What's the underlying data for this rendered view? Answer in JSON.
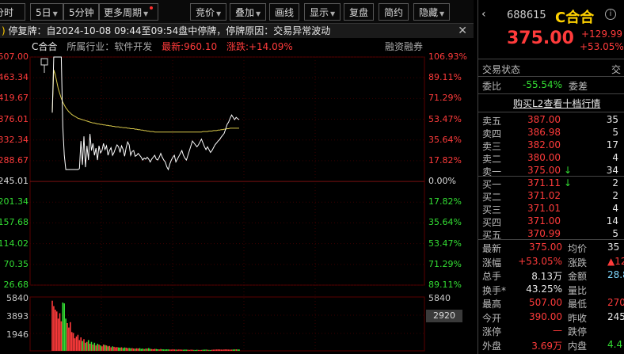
{
  "toolbar": {
    "tab_code": "分时",
    "days": "5日",
    "minute": "5分钟",
    "more_period": "更多周期",
    "auction": "竞价",
    "overlay": "叠加",
    "draw": "画线",
    "display": "显示",
    "review": "复盘",
    "simple": "简约",
    "hide": "隐藏"
  },
  "notice": {
    "text": "停复牌：自2024-10-08 09:44至09:54盘中停牌，停牌原因：交易异常波动",
    "close": "✕"
  },
  "info": {
    "name": "C合合",
    "industry": "所属行业：软件开发",
    "latest": "最新:960.10",
    "change": "涨跌:+14.09%",
    "margin": "融资融券"
  },
  "colors": {
    "up": "#ff3b3b",
    "down": "#33dd33",
    "price_line": "#ffffff",
    "avg_line": "#d8c84a",
    "text": "#c8c8c8",
    "yellow": "#ffd200",
    "blue_label": "#7ab7ff"
  },
  "price_axis": {
    "left_labels": [
      "507.00",
      "463.34",
      "419.67",
      "376.01",
      "332.34",
      "288.67",
      "245.01",
      "201.34",
      "157.68",
      "114.02",
      "70.35",
      "26.68"
    ],
    "right_labels": [
      "106.93%",
      "89.11%",
      "71.29%",
      "53.47%",
      "35.64%",
      "17.82%",
      "0.00%",
      "17.82%",
      "35.64%",
      "53.47%",
      "71.29%",
      "89.11%"
    ]
  },
  "volume_axis": {
    "left_labels": [
      "5840",
      "3893",
      "1946"
    ],
    "right_labels": [
      "5840",
      "3893"
    ],
    "current": "2920"
  },
  "chart_data": {
    "type": "line",
    "x_label": "",
    "y_range": [
      26.68,
      507.0
    ],
    "prev_close": 245.01,
    "series": [
      {
        "values": [
          390.0,
          507.0,
          507.0,
          507.0,
          507.0,
          507.0,
          507.0,
          360.0,
          300.0,
          270.0,
          270.0,
          270.0,
          270.0,
          270.0,
          270.0,
          270.0,
          270.0,
          270.0,
          272.0,
          330.0,
          280.0,
          340.0,
          275.0,
          320.0,
          290.0,
          345.0,
          310.0,
          325.0,
          300.0,
          315.0,
          290.0,
          320.0,
          305.0,
          310.0,
          325.0,
          312.0,
          320.0,
          300.0,
          310.0,
          316.0,
          300.0,
          306.0,
          315.0,
          322.0,
          318.0,
          306.0,
          320.0,
          312.0,
          298.0,
          316.0,
          328.0,
          322.0,
          300.0,
          308.0,
          310.0,
          298.0,
          300.0,
          304.0,
          300.0,
          296.0,
          290.0,
          294.0,
          292.0,
          296.0,
          292.0,
          286.0,
          292.0,
          296.0,
          300.0,
          292.0,
          290.0,
          296.0,
          304.0,
          296.0,
          290.0,
          286.0,
          276.0,
          270.0,
          282.0,
          290.0,
          296.0,
          300.0,
          286.0,
          292.0,
          298.0,
          304.0,
          310.0,
          300.0,
          294.0,
          290.0,
          300.0,
          310.0,
          320.0,
          330.0,
          326.0,
          322.0,
          318.0,
          322.0,
          328.0,
          334.0,
          326.0,
          318.0,
          312.0,
          318.0,
          312.0,
          306.0,
          310.0,
          316.0,
          322.0,
          326.0,
          330.0,
          333.0,
          338.0,
          342.0,
          346.0,
          355.0,
          365.0,
          370.0,
          378.0,
          385.0,
          380.0,
          375.0,
          380.0,
          377.0,
          375.0
        ]
      },
      {
        "values": [
          390.0,
          480.0,
          470.0,
          455.0,
          440.0,
          430.0,
          420.0,
          412.0,
          406.0,
          400.0,
          396.0,
          392.0,
          389.0,
          386.0,
          384.0,
          382.0,
          380.0,
          378.0,
          377.0,
          376.0,
          375.0,
          374.0,
          373.0,
          372.0,
          371.0,
          370.0,
          369.0,
          368.0,
          368.0,
          367.0,
          366.0,
          366.0,
          365.0,
          365.0,
          364.0,
          364.0,
          363.0,
          363.0,
          362.0,
          362.0,
          361.0,
          361.0,
          360.0,
          360.0,
          360.0,
          359.0,
          359.0,
          358.0,
          358.0,
          358.0,
          357.0,
          357.0,
          356.0,
          356.0,
          356.0,
          355.0,
          355.0,
          354.0,
          354.0,
          353.0,
          353.0,
          352.0,
          352.0,
          351.0,
          351.0,
          350.0,
          350.0,
          350.0,
          349.0,
          349.0,
          349.0,
          349.0,
          349.0,
          349.0,
          349.0,
          349.0,
          349.0,
          349.0,
          349.0,
          349.0,
          349.0,
          349.0,
          349.0,
          349.0,
          349.0,
          349.0,
          349.0,
          349.0,
          349.0,
          349.0,
          349.0,
          349.0,
          349.0,
          349.0,
          349.0,
          349.0,
          349.0,
          349.0,
          349.0,
          349.0,
          350.0,
          350.0,
          350.0,
          350.0,
          351.0,
          351.0,
          351.0,
          352.0,
          352.0,
          352.0,
          353.0,
          353.0,
          354.0,
          354.0,
          355.0,
          355.0,
          356.0,
          356.0,
          357.0,
          357.0,
          357.0,
          357.0,
          357.0,
          357.0,
          357.0
        ]
      }
    ],
    "volume": [
      5600,
      5000,
      4600,
      4400,
      3600,
      4200,
      3300,
      5400,
      5300,
      3600,
      3100,
      2600,
      3200,
      2100,
      2000,
      1400,
      1600,
      1800,
      1200,
      1500,
      1100,
      1300,
      900,
      1000,
      1200,
      800,
      1000,
      700,
      900,
      600,
      800,
      700,
      600,
      500,
      700,
      650,
      600,
      500,
      550,
      400,
      500,
      450,
      400,
      420,
      380,
      350,
      400,
      300,
      380,
      350,
      300,
      320,
      280,
      300,
      260,
      240,
      280,
      260,
      300,
      220,
      250,
      200,
      240,
      260,
      300,
      220,
      200,
      180,
      220,
      200,
      180,
      160,
      200,
      180,
      160,
      150,
      170,
      160,
      150,
      140,
      160,
      150,
      140,
      130,
      150,
      140,
      130,
      120,
      140,
      130,
      120,
      110,
      130,
      120,
      110,
      100,
      120,
      110,
      100,
      110,
      120,
      130,
      140,
      120,
      110,
      100,
      120,
      130,
      140,
      150,
      160,
      150,
      140,
      130,
      150,
      160,
      150,
      140,
      130,
      140,
      150,
      160,
      170,
      160,
      150
    ]
  },
  "panel": {
    "code": "688615",
    "name": "C合合",
    "info_icon": "i",
    "price": "375.00",
    "change": "+129.99",
    "change_pct": "+53.05%",
    "trade_status_label": "交易状态",
    "trade_status_right": "交",
    "weibi_label": "委比",
    "weibi_value": "-55.54%",
    "weicha_label": "委差",
    "l2_link": "购买L2查看十档行情",
    "asks": [
      {
        "label": "卖五",
        "price": "387.00",
        "vol": "35"
      },
      {
        "label": "卖四",
        "price": "386.98",
        "vol": "5"
      },
      {
        "label": "卖三",
        "price": "382.00",
        "vol": "17"
      },
      {
        "label": "卖二",
        "price": "380.00",
        "vol": "4"
      },
      {
        "label": "卖一",
        "price": "375.00",
        "vol": "34"
      }
    ],
    "bids": [
      {
        "label": "买一",
        "price": "371.11",
        "vol": "2"
      },
      {
        "label": "买二",
        "price": "371.02",
        "vol": "2"
      },
      {
        "label": "买三",
        "price": "371.01",
        "vol": "4"
      },
      {
        "label": "买四",
        "price": "371.00",
        "vol": "14"
      },
      {
        "label": "买五",
        "price": "370.99",
        "vol": "5"
      }
    ],
    "stats": [
      {
        "l1": "最新",
        "v1": "375.00",
        "c1": "up",
        "l2": "均价",
        "v2": "35"
      },
      {
        "l1": "涨幅",
        "v1": "+53.05%",
        "c1": "up",
        "l2": "涨跌",
        "v2": "▲129"
      },
      {
        "l1": "总手",
        "v1": "8.13万",
        "c1": "text",
        "l2": "金额",
        "v2": "28.8"
      },
      {
        "l1": "换手*",
        "v1": "43.25%",
        "c1": "text",
        "l2": "量比",
        "v2": ""
      },
      {
        "l1": "最高",
        "v1": "507.00",
        "c1": "up",
        "l2": "最低",
        "v2": "270"
      },
      {
        "l1": "今开",
        "v1": "390.00",
        "c1": "up",
        "l2": "昨收",
        "v2": "245"
      },
      {
        "l1": "涨停",
        "v1": "—",
        "c1": "up",
        "l2": "跌停",
        "v2": ""
      },
      {
        "l1": "外盘",
        "v1": "3.69万",
        "c1": "up",
        "l2": "内盘",
        "v2": "4.4"
      }
    ]
  }
}
